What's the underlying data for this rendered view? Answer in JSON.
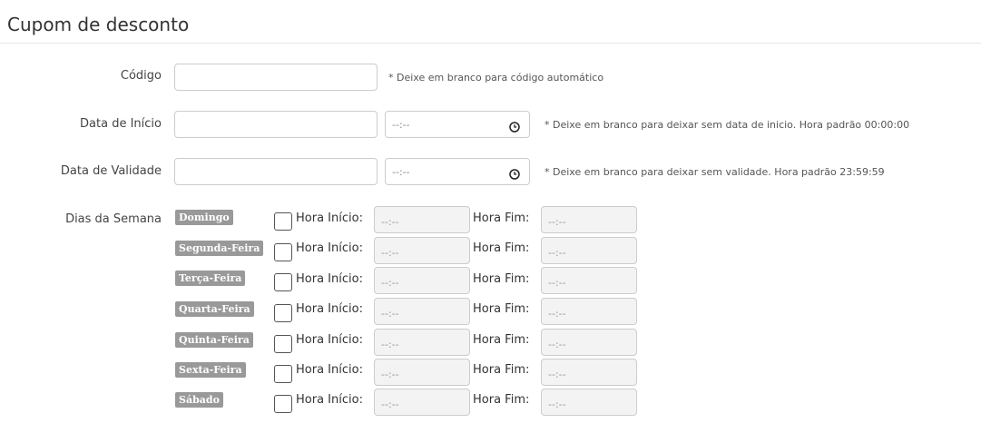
{
  "page": {
    "title": "Cupom de desconto"
  },
  "codigo": {
    "label": "Código",
    "value": "",
    "hint": "* Deixe em branco para código automático"
  },
  "data_inicio": {
    "label": "Data de Início",
    "date_value": "",
    "time_placeholder": "--:--",
    "hint": "* Deixe em branco para deixar sem data de inicio. Hora padrão 00:00:00"
  },
  "data_validade": {
    "label": "Data de Validade",
    "date_value": "",
    "time_placeholder": "--:--",
    "hint": "* Deixe em branco para deixar sem validade. Hora padrão 23:59:59"
  },
  "dias_semana": {
    "label": "Dias da Semana",
    "hora_inicio_label": "Hora Início:",
    "hora_fim_label": "Hora Fim:",
    "time_placeholder": "--:--",
    "days": [
      {
        "name": "Domingo",
        "checked": false
      },
      {
        "name": "Segunda-Feira",
        "checked": false
      },
      {
        "name": "Terça-Feira",
        "checked": false
      },
      {
        "name": "Quarta-Feira",
        "checked": false
      },
      {
        "name": "Quinta-Feira",
        "checked": false
      },
      {
        "name": "Sexta-Feira",
        "checked": false
      },
      {
        "name": "Sábado",
        "checked": false
      }
    ]
  },
  "colors": {
    "badge_bg": "#999999",
    "disabled_input_bg": "#f3f3f3",
    "border": "#cccccc"
  },
  "icons": {
    "time_picker": "clock-icon"
  }
}
